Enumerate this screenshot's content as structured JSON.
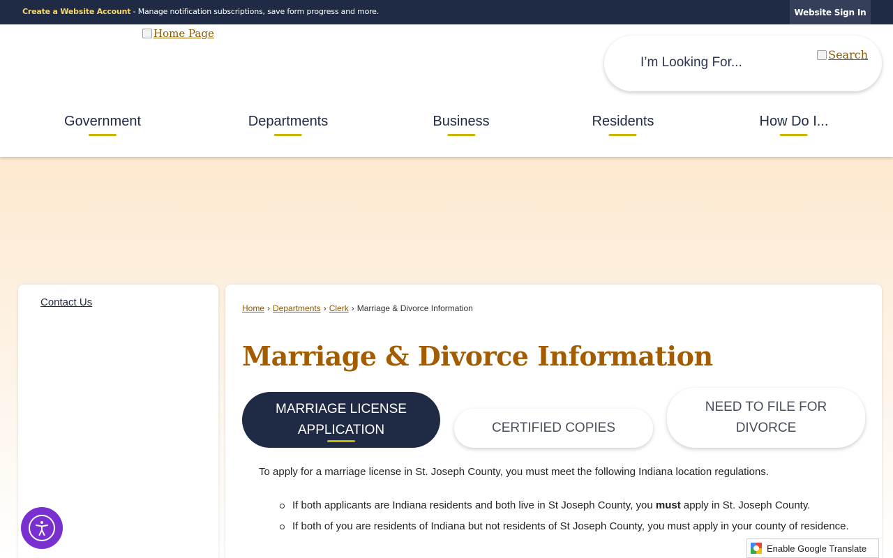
{
  "topbar": {
    "create_account_label": "Create a Website Account",
    "message": " - Manage notification subscriptions, save form progress and more.",
    "signin_label": "Website Sign In"
  },
  "header": {
    "logo_alt": "Home Page",
    "search_placeholder": "I’m Looking For...",
    "search_alt": "Search"
  },
  "nav": [
    {
      "label": "Government"
    },
    {
      "label": "Departments"
    },
    {
      "label": "Business"
    },
    {
      "label": "Residents"
    },
    {
      "label": "How Do I..."
    }
  ],
  "sidebar": {
    "items": [
      {
        "label": "Contact Us"
      }
    ]
  },
  "breadcrumb": {
    "items": [
      {
        "label": "Home"
      },
      {
        "label": "Departments"
      },
      {
        "label": "Clerk"
      }
    ],
    "current": "Marriage & Divorce Information",
    "separator": "›"
  },
  "page_title": "Marriage & Divorce Information",
  "tabs": [
    {
      "line1": "MARRIAGE LICENSE",
      "line2": "APPLICATION",
      "active": true
    },
    {
      "line1": "CERTIFIED COPIES",
      "line2": "",
      "active": false
    },
    {
      "line1": "NEED TO FILE FOR",
      "line2": "DIVORCE",
      "active": false
    }
  ],
  "content": {
    "intro": "To apply for a marriage license in St. Joseph County, you must meet the following Indiana location regulations.",
    "rules": [
      {
        "before": "If both applicants are Indiana residents and both live in St Joseph County, you ",
        "bold": "must",
        "after": " apply in St. Joseph County."
      },
      {
        "before": "If both of you are residents of Indiana but not residents of St Joseph County, you must apply in your county of residence.",
        "bold": "",
        "after": ""
      }
    ]
  },
  "translate": {
    "label": "Enable Google Translate"
  },
  "colors": {
    "navy": "#1f2a44",
    "gold_title": "#a35c00",
    "accent_bar": "#c6b800",
    "link": "#8a5a00",
    "a11y_purple": "#7a2fd0"
  },
  "icons": {
    "accessibility": "accessibility-icon",
    "google": "google-translate-icon"
  }
}
